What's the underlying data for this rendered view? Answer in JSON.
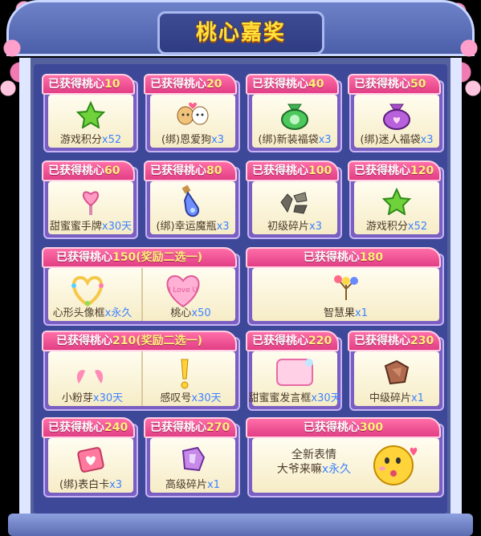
{
  "title": "桃心嘉奖",
  "header_prefix": "已获得桃心",
  "rewards": [
    {
      "req": "10",
      "name": "游戏积分",
      "count": "x52"
    },
    {
      "req": "20",
      "name": "(绑)恩爱狗",
      "count": "x3"
    },
    {
      "req": "40",
      "name": "(绑)新装福袋",
      "count": "x3"
    },
    {
      "req": "50",
      "name": "(绑)迷人福袋",
      "count": "x3"
    },
    {
      "req": "60",
      "name": "甜蜜蜜手牌",
      "count": "x30天"
    },
    {
      "req": "80",
      "name": "(绑)幸运魔瓶",
      "count": "x3"
    },
    {
      "req": "100",
      "name": "初级碎片",
      "count": "x3"
    },
    {
      "req": "120",
      "name": "游戏积分",
      "count": "x52"
    },
    {
      "req": "150",
      "suffix": "(奖励二选一)",
      "items": [
        {
          "name": "心形头像框",
          "count": "x永久"
        },
        {
          "name": "桃心",
          "count": "x50"
        }
      ]
    },
    {
      "req": "180",
      "name": "智慧果",
      "count": "x1"
    },
    {
      "req": "210",
      "suffix": "(奖励二选一)",
      "items": [
        {
          "name": "小粉芽",
          "count": "x30天"
        },
        {
          "name": "感叹号",
          "count": "x30天"
        }
      ]
    },
    {
      "req": "220",
      "name": "甜蜜蜜发言框",
      "count": "x30天"
    },
    {
      "req": "230",
      "name": "中级碎片",
      "count": "x1"
    },
    {
      "req": "240",
      "name": "(绑)表白卡",
      "count": "x3"
    },
    {
      "req": "270",
      "name": "高级碎片",
      "count": "x1"
    },
    {
      "req": "300",
      "line1": "全新表情",
      "line2": "大爷来嘛",
      "count": "x永久"
    }
  ],
  "heart_text": "I Love U",
  "colors": {
    "header": "#e23e85",
    "number": "#fff27a",
    "count": "#3e83ff",
    "title": "#ffe23b"
  }
}
